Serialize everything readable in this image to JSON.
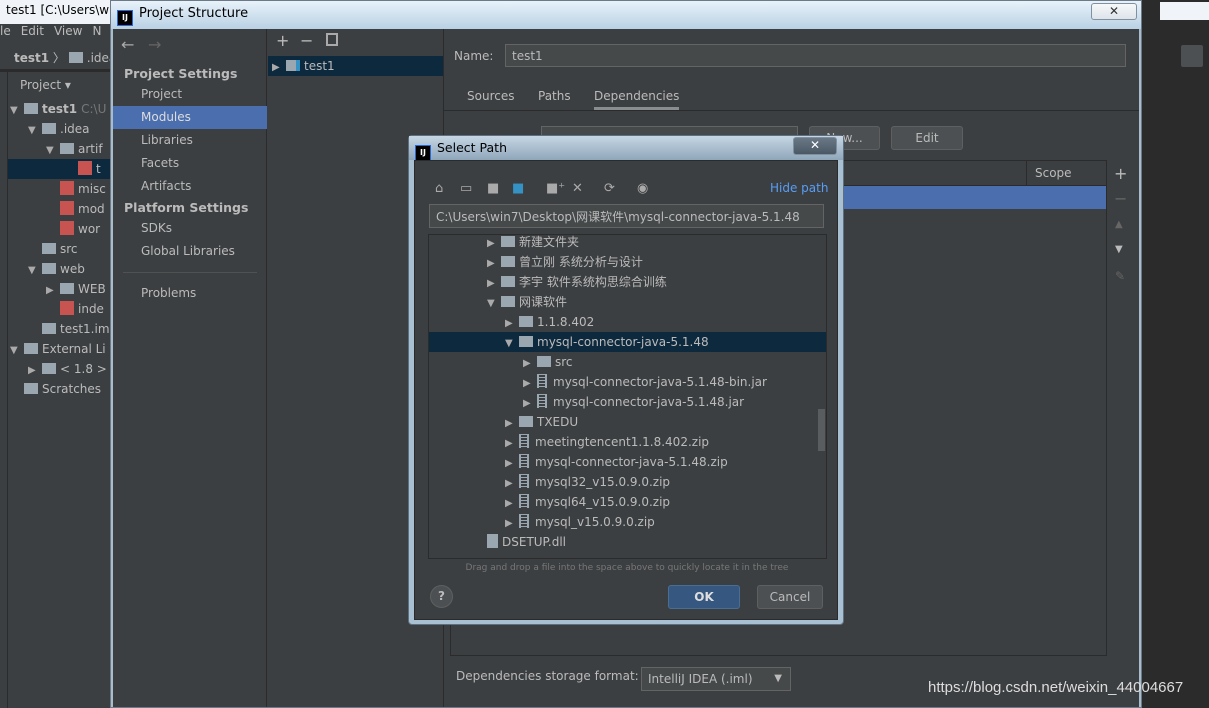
{
  "ide": {
    "title": "test1 [C:\\Users\\w",
    "menu": [
      "le",
      "Edit",
      "View",
      "N"
    ],
    "breadcrumb": [
      "test1",
      ".idea"
    ],
    "project_view": "Project",
    "tree": [
      {
        "label": "test1",
        "suffix": "C:\\U",
        "level": 0,
        "arrow": "down",
        "icon": "module"
      },
      {
        "label": ".idea",
        "level": 1,
        "arrow": "down",
        "icon": "folder"
      },
      {
        "label": "artif",
        "level": 2,
        "arrow": "down",
        "icon": "folder"
      },
      {
        "label": "t",
        "level": 3,
        "icon": "xml",
        "selected": true
      },
      {
        "label": "misc",
        "level": 2,
        "icon": "xml"
      },
      {
        "label": "mod",
        "level": 2,
        "icon": "xml"
      },
      {
        "label": "wor",
        "level": 2,
        "icon": "xml"
      },
      {
        "label": "src",
        "level": 1,
        "icon": "folder"
      },
      {
        "label": "web",
        "level": 1,
        "arrow": "down",
        "icon": "folder"
      },
      {
        "label": "WEB",
        "level": 2,
        "arrow": "right",
        "icon": "folder"
      },
      {
        "label": "inde",
        "level": 2,
        "icon": "jsp"
      },
      {
        "label": "test1.im",
        "level": 1,
        "icon": "file"
      },
      {
        "label": "External Li",
        "level": 0,
        "arrow": "down",
        "icon": "library"
      },
      {
        "label": "< 1.8 >",
        "level": 1,
        "arrow": "right",
        "icon": "jdk"
      },
      {
        "label": "Scratches",
        "level": 0,
        "icon": "scratch"
      }
    ]
  },
  "project_structure": {
    "title": "Project Structure",
    "icon_text": "IJ",
    "nav": {
      "project_settings": "Project Settings",
      "items1": [
        "Project",
        "Modules",
        "Libraries",
        "Facets",
        "Artifacts"
      ],
      "platform_settings": "Platform Settings",
      "items2": [
        "SDKs",
        "Global Libraries"
      ],
      "problems": "Problems",
      "selected": "Modules"
    },
    "modules": [
      "test1"
    ],
    "name_label": "Name:",
    "name_value": "test1",
    "tabs": [
      "Sources",
      "Paths",
      "Dependencies"
    ],
    "active_tab": "Dependencies",
    "sdk_new": "New...",
    "sdk_edit": "Edit",
    "table_scope_header": "Scope",
    "storage_label": "Dependencies storage format:",
    "storage_value": "IntelliJ IDEA (.iml)"
  },
  "select_path": {
    "title": "Select Path",
    "hide_path": "Hide path",
    "path": "C:\\Users\\win7\\Desktop\\网课软件\\mysql-connector-java-5.1.48",
    "tree": [
      {
        "label": "新建文件夹",
        "level": 1,
        "arrow": "right",
        "type": "folder"
      },
      {
        "label": "曾立刚 系统分析与设计",
        "level": 1,
        "arrow": "right",
        "type": "folder"
      },
      {
        "label": "李宇 软件系统构思综合训练",
        "level": 1,
        "arrow": "right",
        "type": "folder"
      },
      {
        "label": "网课软件",
        "level": 1,
        "arrow": "down",
        "type": "folder"
      },
      {
        "label": "1.1.8.402",
        "level": 2,
        "arrow": "right",
        "type": "folder"
      },
      {
        "label": "mysql-connector-java-5.1.48",
        "level": 2,
        "arrow": "down",
        "type": "folder",
        "selected": true
      },
      {
        "label": "src",
        "level": 3,
        "arrow": "right",
        "type": "folder"
      },
      {
        "label": "mysql-connector-java-5.1.48-bin.jar",
        "level": 3,
        "arrow": "right",
        "type": "jar"
      },
      {
        "label": "mysql-connector-java-5.1.48.jar",
        "level": 3,
        "arrow": "right",
        "type": "jar"
      },
      {
        "label": "TXEDU",
        "level": 2,
        "arrow": "right",
        "type": "folder"
      },
      {
        "label": "meetingtencent1.1.8.402.zip",
        "level": 2,
        "arrow": "right",
        "type": "jar"
      },
      {
        "label": "mysql-connector-java-5.1.48.zip",
        "level": 2,
        "arrow": "right",
        "type": "jar"
      },
      {
        "label": "mysql32_v15.0.9.0.zip",
        "level": 2,
        "arrow": "right",
        "type": "jar"
      },
      {
        "label": "mysql64_v15.0.9.0.zip",
        "level": 2,
        "arrow": "right",
        "type": "jar"
      },
      {
        "label": "mysql_v15.0.9.0.zip",
        "level": 2,
        "arrow": "right",
        "type": "jar"
      },
      {
        "label": "DSETUP.dll",
        "level": 1,
        "type": "file"
      }
    ],
    "hint": "Drag and drop a file into the space above to quickly locate it in the tree",
    "ok": "OK",
    "cancel": "Cancel",
    "help": "?"
  },
  "watermark": "https://blog.csdn.net/weixin_44004667",
  "colors": {
    "selection": "#4b6eaf",
    "tree_selection": "#0d293e",
    "link": "#589df6",
    "ok_button": "#365880"
  }
}
